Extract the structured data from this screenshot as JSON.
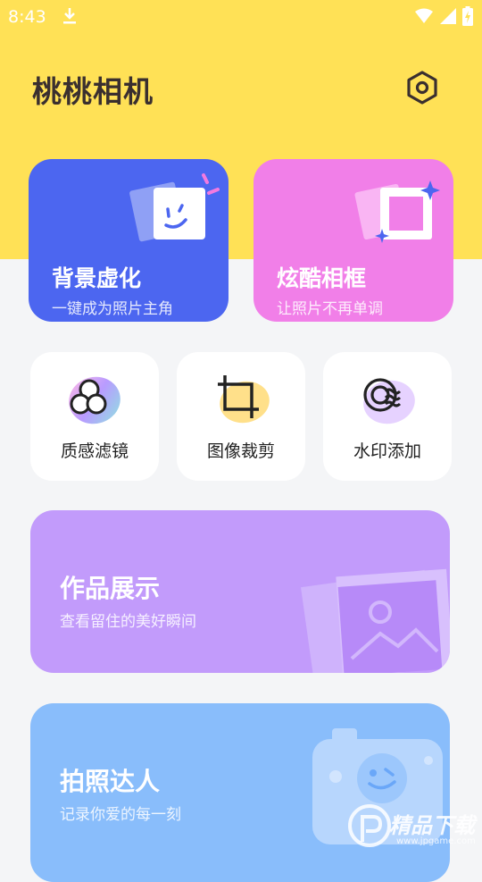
{
  "status": {
    "time": "8:43"
  },
  "app": {
    "title": "桃桃相机"
  },
  "cards": {
    "bg_blur": {
      "title": "背景虚化",
      "subtitle": "一键成为照片主角"
    },
    "frame": {
      "title": "炫酷相框",
      "subtitle": "让照片不再单调"
    }
  },
  "tools": [
    {
      "label": "质感滤镜",
      "icon": "filter-circles-icon"
    },
    {
      "label": "图像裁剪",
      "icon": "crop-icon"
    },
    {
      "label": "水印添加",
      "icon": "watermark-waves-icon"
    }
  ],
  "showcase": {
    "title": "作品展示",
    "subtitle": "查看留住的美好瞬间"
  },
  "expert": {
    "title": "拍照达人",
    "subtitle": "记录你爱的每一刻"
  },
  "watermark": {
    "text": "精品下载",
    "url": "www.jpgame.com"
  },
  "colors": {
    "header": "#FFE156",
    "blue_card": "#4C66F0",
    "pink_card": "#F17FE8",
    "purple_card": "#C29BFB",
    "lightblue_card": "#89BDFB"
  }
}
